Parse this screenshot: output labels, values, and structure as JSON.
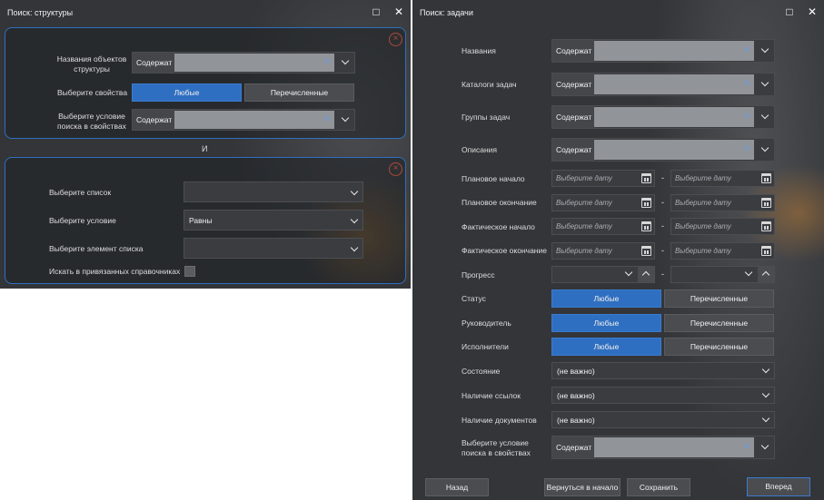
{
  "left_window": {
    "title": "Поиск: структуры",
    "maximize_glyph": "□",
    "close_glyph": "✕",
    "panel1": {
      "names_label": "Названия объектов структуры",
      "contains_tag": "Содержат",
      "props_label": "Выберите свойства",
      "any_label": "Любые",
      "listed_label": "Перечисленные",
      "cond_label": "Выберите условие поиска в свойствах",
      "contains_tag2": "Содержат"
    },
    "and_label": "И",
    "panel2": {
      "list_label": "Выберите список",
      "cond_label": "Выберите условие",
      "cond_value": "Равны",
      "elem_label": "Выберите элемент списка",
      "linked_label": "Искать в привязанных справочниках"
    }
  },
  "right_window": {
    "title": "Поиск: задачи",
    "maximize_glyph": "□",
    "close_glyph": "✕",
    "contains_tag": "Содержат",
    "rows": {
      "names": "Названия",
      "catalogs": "Каталоги задач",
      "groups": "Группы задач",
      "descriptions": "Описания",
      "planned_start": "Плановое начало",
      "planned_end": "Плановое окончание",
      "actual_start": "Фактическое начало",
      "actual_end": "Фактическое окончание",
      "progress": "Прогресс",
      "status": "Статус",
      "manager": "Руководитель",
      "executors": "Исполнители",
      "state": "Состояние",
      "links": "Наличие ссылок",
      "documents": "Наличие документов",
      "cond": "Выберите условие поиска в свойствах"
    },
    "date_placeholder": "Выберите дату",
    "range_dash": "-",
    "any_label": "Любые",
    "listed_label": "Перечисленные",
    "not_important": "(не важно)",
    "footer": {
      "back": "Назад",
      "return_start": "Вернуться в начало",
      "save": "Сохранить",
      "forward": "Вперед"
    }
  }
}
